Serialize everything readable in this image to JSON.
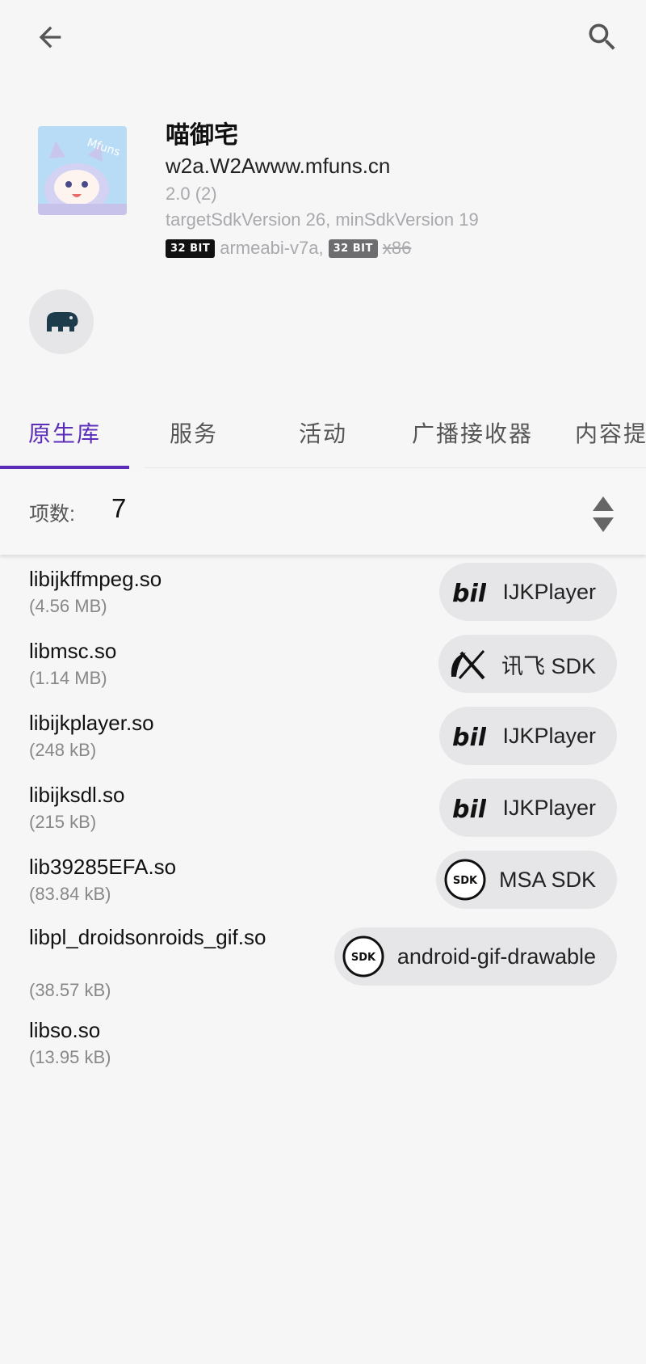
{
  "app": {
    "name": "喵御宅",
    "package": "w2a.W2Awww.mfuns.cn",
    "version": "2.0 (2)",
    "sdk_info": "targetSdkVersion 26, minSdkVersion 19",
    "abi": [
      {
        "badge": "32 BIT",
        "value": "armeabi-v7a,",
        "style": "black"
      },
      {
        "badge": "32 BIT",
        "value": "x86",
        "style": "gray",
        "strikethrough": true
      }
    ],
    "icon_text": "Mfuns"
  },
  "tabs": [
    {
      "label": "原生库",
      "active": true
    },
    {
      "label": "服务",
      "active": false
    },
    {
      "label": "活动",
      "active": false
    },
    {
      "label": "广播接收器",
      "active": false
    },
    {
      "label": "内容提",
      "active": false
    }
  ],
  "count": {
    "label": "项数:",
    "value": "7"
  },
  "libraries": [
    {
      "name": "libijkffmpeg.so",
      "size": "(4.56 MB)",
      "chip": {
        "label": "IJKPlayer",
        "icon": "bilibili-icon"
      }
    },
    {
      "name": "libmsc.so",
      "size": "(1.14 MB)",
      "chip": {
        "label": "讯飞 SDK",
        "icon": "iflytek-icon"
      }
    },
    {
      "name": "libijkplayer.so",
      "size": "(248 kB)",
      "chip": {
        "label": "IJKPlayer",
        "icon": "bilibili-icon"
      }
    },
    {
      "name": "libijksdl.so",
      "size": "(215 kB)",
      "chip": {
        "label": "IJKPlayer",
        "icon": "bilibili-icon"
      }
    },
    {
      "name": "lib39285EFA.so",
      "size": "(83.84 kB)",
      "chip": {
        "label": "MSA SDK",
        "icon": "sdk-icon"
      }
    },
    {
      "name": "libpl_droidsonroids_gif.so",
      "size": "(38.57 kB)",
      "chip": {
        "label": "android-gif-drawable",
        "icon": "sdk-icon"
      }
    },
    {
      "name": "libso.so",
      "size": "(13.95 kB)",
      "chip": null
    }
  ],
  "colors": {
    "accent": "#5b2db8",
    "background": "#f6f6f7",
    "chip": "#e6e6e8"
  }
}
